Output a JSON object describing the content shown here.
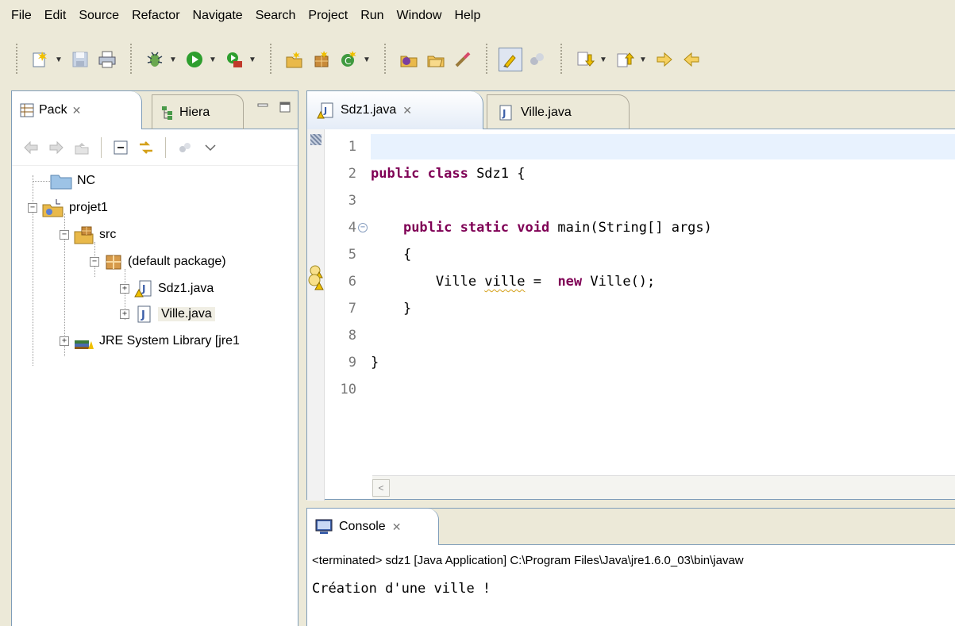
{
  "menu": [
    "File",
    "Edit",
    "Source",
    "Refactor",
    "Navigate",
    "Search",
    "Project",
    "Run",
    "Window",
    "Help"
  ],
  "toolbar": {
    "icons": [
      "new-wizard-icon",
      "save-icon",
      "print-icon",
      "debug-icon",
      "run-icon",
      "external-tools-icon",
      "new-java-project-icon",
      "new-package-icon",
      "new-class-icon",
      "open-type-icon",
      "open-task-icon",
      "search-icon",
      "mark-occurrences-icon",
      "annotations-icon",
      "next-annotation-icon",
      "previous-annotation-icon",
      "forward-icon",
      "back-icon"
    ]
  },
  "left_view": {
    "tabs": [
      {
        "label": "Pack",
        "close": "✕"
      },
      {
        "label": "Hiera"
      }
    ],
    "tree": [
      {
        "label": "NC",
        "icon": "project-folder-icon"
      },
      {
        "label": "projet1",
        "icon": "java-project-icon",
        "expander": "−"
      },
      {
        "label": "src",
        "icon": "source-folder-icon",
        "expander": "−"
      },
      {
        "label": "(default package)",
        "icon": "package-icon",
        "expander": "−"
      },
      {
        "label": "Sdz1.java",
        "icon": "java-file-warning-icon",
        "expander": "+"
      },
      {
        "label": "Ville.java",
        "icon": "java-file-icon",
        "expander": "+"
      },
      {
        "label": "JRE System Library [jre1",
        "icon": "library-icon",
        "expander": "+"
      }
    ]
  },
  "editor": {
    "tabs": [
      {
        "label": "Sdz1.java",
        "close": "✕"
      },
      {
        "label": "Ville.java"
      }
    ],
    "lines": [
      {
        "n": "1",
        "tokens": []
      },
      {
        "n": "2",
        "tokens": [
          {
            "t": "public class",
            "k": true
          },
          {
            "t": " Sdz1 {"
          }
        ]
      },
      {
        "n": "3",
        "tokens": []
      },
      {
        "n": "4",
        "tokens": [
          {
            "t": "    "
          },
          {
            "t": "public static void",
            "k": true
          },
          {
            "t": " main(String[] args)"
          }
        ],
        "fold": true
      },
      {
        "n": "5",
        "tokens": [
          {
            "t": "    {"
          }
        ]
      },
      {
        "n": "6",
        "tokens": [
          {
            "t": "        Ville "
          },
          {
            "t": "ville",
            "w": true
          },
          {
            "t": " =  "
          },
          {
            "t": "new",
            "k": true
          },
          {
            "t": " Ville();"
          }
        ],
        "warning": true
      },
      {
        "n": "7",
        "tokens": [
          {
            "t": "    }"
          }
        ]
      },
      {
        "n": "8",
        "tokens": []
      },
      {
        "n": "9",
        "tokens": [
          {
            "t": "}"
          }
        ]
      },
      {
        "n": "10",
        "tokens": []
      }
    ],
    "scroll_left": "<"
  },
  "console": {
    "tab_label": "Console",
    "tab_close": "✕",
    "status": "<terminated> sdz1 [Java Application] C:\\Program Files\\Java\\jre1.6.0_03\\bin\\javaw",
    "output": "Création d'une ville !"
  },
  "colors": {
    "keyword": "#7f0055",
    "chrome": "#ece9d8",
    "border": "#7f9db9"
  }
}
